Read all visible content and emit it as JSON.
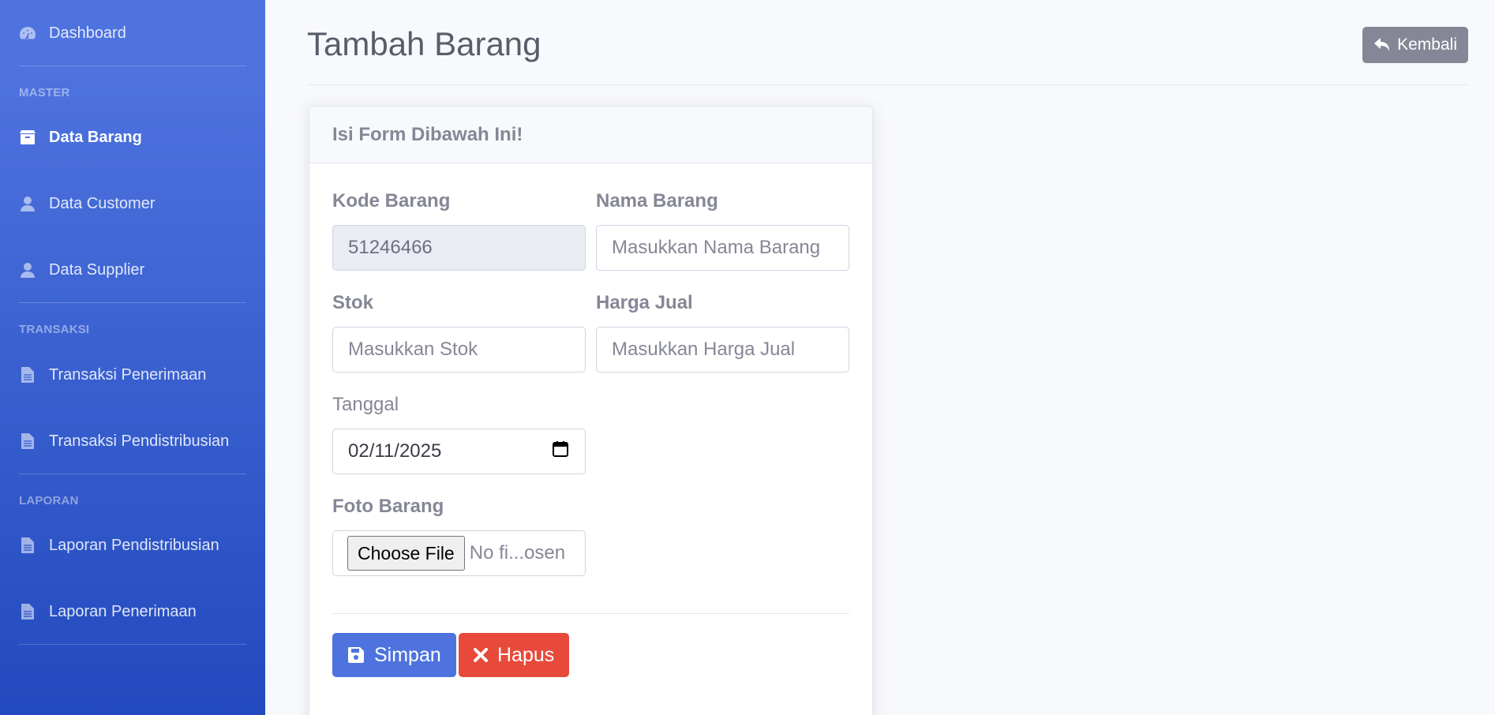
{
  "sidebar": {
    "dashboard": "Dashboard",
    "heading_master": "MASTER",
    "data_barang": "Data Barang",
    "data_customer": "Data Customer",
    "data_supplier": "Data Supplier",
    "heading_transaksi": "TRANSAKSI",
    "transaksi_penerimaan": "Transaksi Penerimaan",
    "transaksi_pendistribusian": "Transaksi Pendistribusian",
    "heading_laporan": "LAPORAN",
    "laporan_pendistribusian": "Laporan Pendistribusian",
    "laporan_penerimaan": "Laporan Penerimaan",
    "active_item": "Data Barang"
  },
  "header": {
    "title": "Tambah Barang",
    "back_label": "Kembali"
  },
  "form": {
    "card_title": "Isi Form Dibawah Ini!",
    "kode_label": "Kode Barang",
    "kode_value": "51246466",
    "nama_label": "Nama Barang",
    "nama_placeholder": "Masukkan Nama Barang",
    "stok_label": "Stok",
    "stok_placeholder": "Masukkan Stok",
    "harga_label": "Harga Jual",
    "harga_placeholder": "Masukkan Harga Jual",
    "tanggal_label": "Tanggal",
    "tanggal_value": "02/11/2025",
    "foto_label": "Foto Barang",
    "choose_file_label": "Choose File",
    "file_status": "No fi...osen",
    "save_label": "Simpan",
    "delete_label": "Hapus"
  },
  "colors": {
    "primary": "#4e73df",
    "danger": "#e74a3b",
    "secondary": "#858796"
  }
}
